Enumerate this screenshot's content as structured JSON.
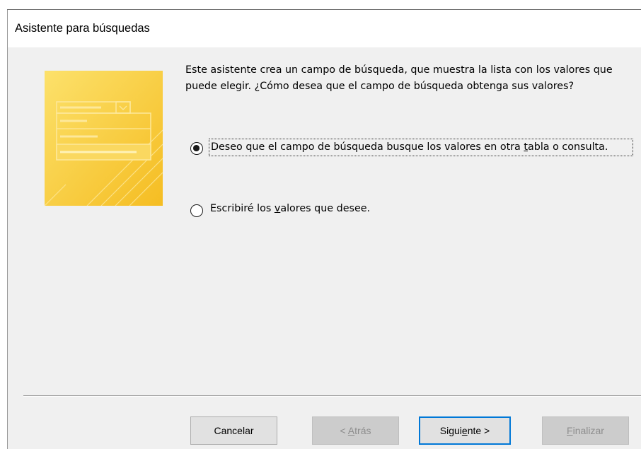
{
  "window": {
    "title": "Asistente para búsquedas"
  },
  "description": "Este asistente crea un campo de búsqueda, que muestra la lista con los valores que puede elegir. ¿Cómo desea que el campo de búsqueda obtenga sus valores?",
  "options": [
    {
      "label_before": "Deseo que el campo de búsqueda busque los valores en otra ",
      "label_accel": "t",
      "label_after": "abla o consulta.",
      "selected": true
    },
    {
      "label_before": "Escribiré los ",
      "label_accel": "v",
      "label_after": "alores que desee.",
      "selected": false
    }
  ],
  "buttons": {
    "cancel": {
      "before": "Cancelar",
      "accel": "",
      "after": ""
    },
    "back": {
      "before": "< ",
      "accel": "A",
      "after": "trás",
      "enabled": false
    },
    "next": {
      "before": "Sigui",
      "accel": "e",
      "after": "nte >",
      "enabled": true
    },
    "finish": {
      "before": "",
      "accel": "F",
      "after": "inalizar",
      "enabled": false
    }
  },
  "colors": {
    "illustration_yellow": "#f7c12e",
    "illustration_light": "#fce07a",
    "focus_blue": "#0078d7"
  }
}
